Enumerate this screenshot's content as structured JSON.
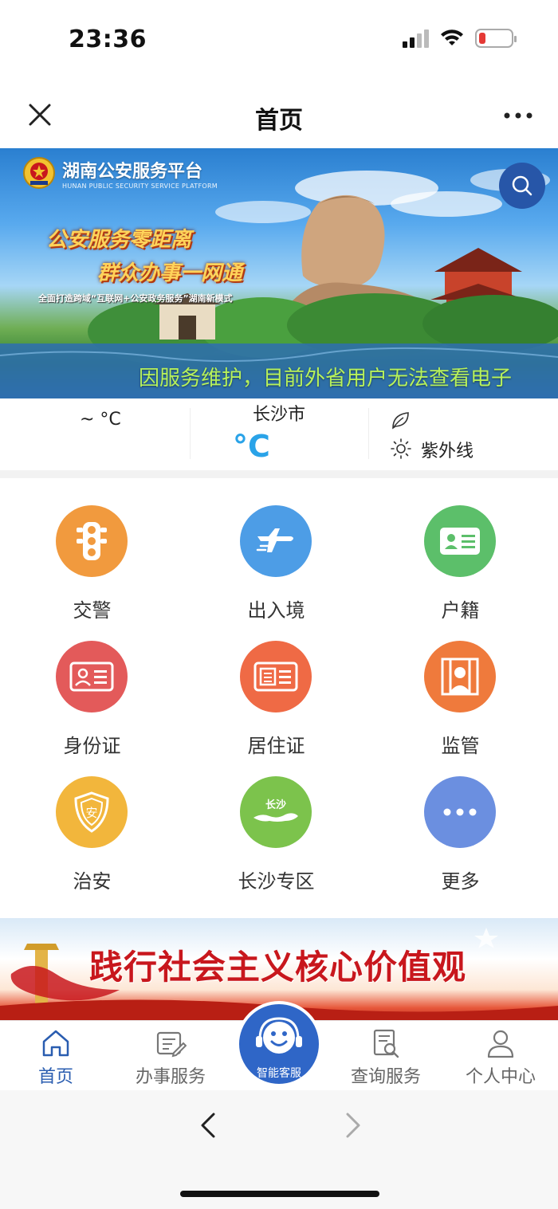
{
  "status_bar": {
    "time": "23:36",
    "battery_level": 0.12,
    "battery_color": "#e53935"
  },
  "nav": {
    "title": "首页",
    "close_icon": "close-icon",
    "more_icon": "more-icon"
  },
  "banner": {
    "platform_name": "湖南公安服务平台",
    "platform_name_en": "HUNAN PUBLIC SECURITY SERVICE PLATFORM",
    "slogan_line1": "公安服务零距离",
    "slogan_line2": "群众办事一网通",
    "slogan_line3": "全面打造跨域“互联网+公安政务服务”湖南新模式",
    "marquee": "因服务维护，目前外省用户无法查看电子",
    "search_icon": "search-icon"
  },
  "weather": {
    "temp_range": "~ °C",
    "city": "长沙市",
    "temp": "°C",
    "uv_label": "紫外线",
    "temp_color": "#2aa3e8"
  },
  "services": [
    {
      "label": "交警",
      "icon": "traffic-light-icon",
      "color": "#f19a3e"
    },
    {
      "label": "出入境",
      "icon": "airplane-icon",
      "color": "#4d9de6"
    },
    {
      "label": "户籍",
      "icon": "household-card-icon",
      "color": "#5cbf6a"
    },
    {
      "label": "身份证",
      "icon": "id-card-icon",
      "color": "#e35a5a"
    },
    {
      "label": "居住证",
      "icon": "residence-card-icon",
      "color": "#ef6a45"
    },
    {
      "label": "监管",
      "icon": "detention-icon",
      "color": "#ef7a3c"
    },
    {
      "label": "治安",
      "icon": "shield-icon",
      "color": "#f2b63c"
    },
    {
      "label": "长沙专区",
      "icon": "changsha-icon",
      "color": "#7cc34c"
    },
    {
      "label": "更多",
      "icon": "more-dots-icon",
      "color": "#6b8fe0"
    }
  ],
  "values_banner": {
    "text": "践行社会主义核心价值观"
  },
  "tabs": [
    {
      "label": "首页",
      "icon": "home-icon",
      "active": true
    },
    {
      "label": "办事服务",
      "icon": "form-edit-icon",
      "active": false
    },
    {
      "label": "智能客服",
      "icon": "assistant-icon",
      "active": false
    },
    {
      "label": "查询服务",
      "icon": "search-doc-icon",
      "active": false
    },
    {
      "label": "个人中心",
      "icon": "user-icon",
      "active": false
    }
  ],
  "colors": {
    "accent": "#2a5db0",
    "center_button": "#2f66c7"
  }
}
